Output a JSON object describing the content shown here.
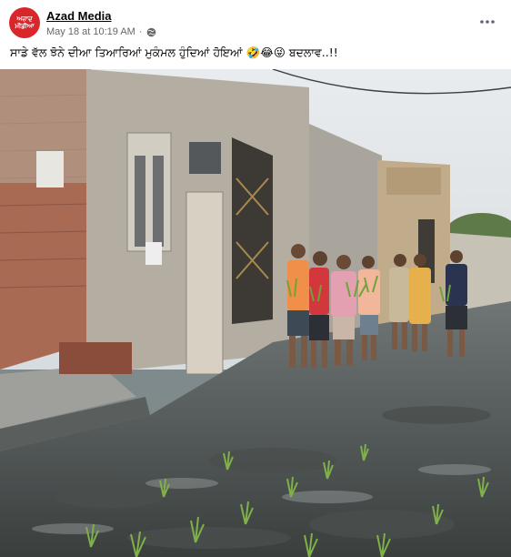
{
  "post": {
    "page_name": "Azad Media",
    "avatar_text": [
      "ਅਜ਼ਾਦ",
      "ਮੀਡੀਆ"
    ],
    "timestamp": "May 18 at 10:19 AM",
    "privacy_separator": "·",
    "privacy_icon": "globe-icon",
    "more_icon": "more-options-icon",
    "caption": "ਸਾਡੇ ਵੱਲ ਝੋਨੇ ਦੀਆ ਤਿਆਰਿਆਂ ਮੁਕੰਮਲ ਹੁੰਦਿਆਂ ਹੋਇਆਂ 🤣😂😜   ਬਦਲਾਵ..!!"
  },
  "colors": {
    "brand": "#d9262b",
    "meta_text": "#65676b",
    "name_text": "#050505"
  }
}
